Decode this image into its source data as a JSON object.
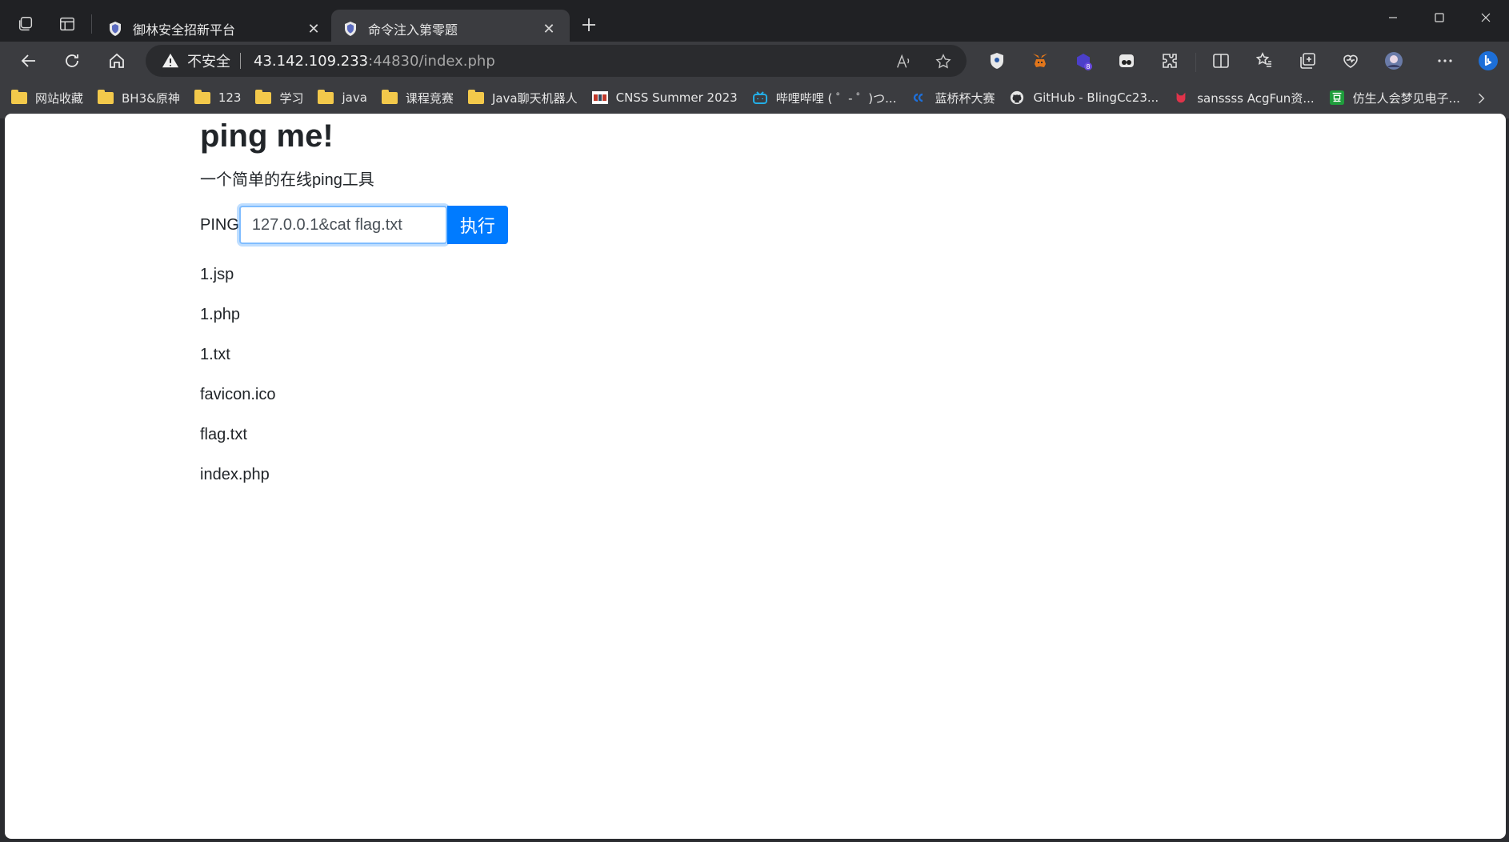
{
  "browser": {
    "tabs": [
      {
        "title": "御林安全招新平台",
        "active": false
      },
      {
        "title": "命令注入第零题",
        "active": true
      }
    ],
    "address": {
      "security_label": "不安全",
      "host": "43.142.109.233",
      "rest": ":44830/index.php"
    },
    "bookmarks": [
      {
        "label": "网站收藏",
        "icon": "folder-icon"
      },
      {
        "label": "BH3&原神",
        "icon": "folder-icon"
      },
      {
        "label": "123",
        "icon": "folder-icon"
      },
      {
        "label": "学习",
        "icon": "folder-icon"
      },
      {
        "label": "java",
        "icon": "folder-icon"
      },
      {
        "label": "课程竞赛",
        "icon": "folder-icon"
      },
      {
        "label": "Java聊天机器人",
        "icon": "folder-icon"
      },
      {
        "label": "CNSS Summer 2023",
        "icon": "cnss-icon"
      },
      {
        "label": "哔哩哔哩 ( ゜- ゜)つ...",
        "icon": "bilibili-icon"
      },
      {
        "label": "蓝桥杯大赛",
        "icon": "lanqiao-icon"
      },
      {
        "label": "GitHub - BlingCc23...",
        "icon": "github-icon"
      },
      {
        "label": "sanssss AcgFun资...",
        "icon": "acgfun-icon"
      },
      {
        "label": "仿生人会梦见电子...",
        "icon": "douban-icon"
      }
    ],
    "extension_badge": "8"
  },
  "page": {
    "title": "ping me!",
    "subtitle": "一个简单的在线ping工具",
    "form": {
      "label": "PING",
      "input_value": "127.0.0.1&cat flag.txt",
      "submit_label": "执行"
    },
    "results": [
      "1.jsp",
      "1.php",
      "1.txt",
      "favicon.ico",
      "flag.txt",
      "index.php"
    ]
  },
  "colors": {
    "primary": "#007bff",
    "focus_border": "#80bdff",
    "text": "#212529"
  }
}
